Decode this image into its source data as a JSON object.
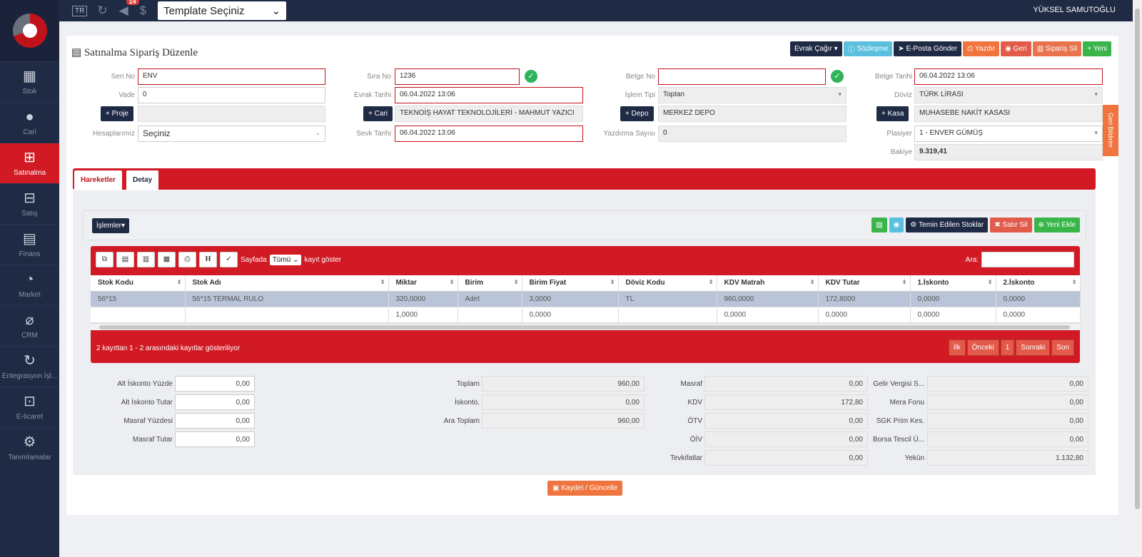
{
  "topbar": {
    "lang": "TR",
    "notif_count": "14",
    "template": "Template Seçiniz",
    "user": "YÜKSEL SAMUTOĞLU"
  },
  "sidebar": {
    "items": [
      {
        "label": "Stok",
        "icon": "cubes-icon"
      },
      {
        "label": "Cari",
        "icon": "user-icon"
      },
      {
        "label": "Satınalma",
        "icon": "cart-plus-icon",
        "active": true
      },
      {
        "label": "Satış",
        "icon": "cart-icon"
      },
      {
        "label": "Finans",
        "icon": "archive-icon"
      },
      {
        "label": "Market",
        "icon": "dashboard-icon"
      },
      {
        "label": "CRM",
        "icon": "paperclip-icon"
      },
      {
        "label": "Entegrasyon İşl...",
        "icon": "refresh-icon"
      },
      {
        "label": "E-ticaret",
        "icon": "shopping-cart-icon"
      },
      {
        "label": "Tanımlamalar",
        "icon": "cogs-icon"
      }
    ]
  },
  "header": {
    "title": "Satınalma Sipariş Düzenle",
    "buttons": {
      "evrak": "Evrak Çağır",
      "sozlesme": "Sözleşme",
      "eposta": "E-Posta Gönder",
      "yazdir": "Yazdır",
      "geri": "Geri",
      "sil": "Sipariş Sil",
      "yeni": "Yeni"
    }
  },
  "form": {
    "seri_label": "Seri No",
    "seri": "ENV",
    "sira_label": "Sıra No",
    "sira": "1236",
    "belge_label": "Belge No",
    "belge": "",
    "belge_tarih_label": "Belge Tarihi",
    "belge_tarih": "06.04.2022 13:06",
    "vade_label": "Vade",
    "vade": "0",
    "evrak_tarih_label": "Evrak Tarihi",
    "evrak_tarih": "06.04.2022 13:06",
    "islem_label": "İşlem Tipi",
    "islem": "Toptan",
    "doviz_label": "Döviz",
    "doviz": "TÜRK LİRASI",
    "proje_btn": "Proje",
    "proje": "",
    "cari_btn": "Cari",
    "cari": "TEKNOİŞ HAYAT TEKNOLOJİLERİ - MAHMUT YAZICI",
    "depo_btn": "Depo",
    "depo": "MERKEZ DEPO",
    "kasa_btn": "Kasa",
    "kasa": "MUHASEBE NAKİT KASASI",
    "hesap_label": "Hesaplarımız",
    "hesap": "Seçiniz",
    "sevk_label": "Sevk Tarihi",
    "sevk": "06.04.2022 13:06",
    "yazdirma_label": "Yazdırma Sayısı",
    "yazdirma": "0",
    "plasiyer_label": "Plasiyer",
    "plasiyer": "1 - ENVER GÜMÜŞ",
    "bakiye_label": "Bakiye",
    "bakiye": "9.319,41",
    "side_tab": "Geri Bildirim"
  },
  "tabs": [
    "Hareketler",
    "Detay"
  ],
  "toolbar": {
    "islemler": "İşlemler",
    "temin": "Temin Edilen Stoklar",
    "satir_sil": "Satır Sil",
    "yeni_ekle": "Yeni Ekle"
  },
  "grid": {
    "sayfada": "Sayfada",
    "tumu": "Tümü",
    "kayit": "kayıt göster",
    "ara": "Ara:",
    "columns": [
      "Stok Kodu",
      "Stok Adı",
      "Miktar",
      "Birim",
      "Birim Fiyat",
      "Döviz Kodu",
      "KDV Matrah",
      "KDV Tutar",
      "1.İskonto",
      "2.İskonto"
    ],
    "rows": [
      [
        "56*15",
        "56*15 TERMAL RULO",
        "320,0000",
        "Adet",
        "3,0000",
        "TL",
        "960,0000",
        "172,8000",
        "0,0000",
        "0,0000"
      ],
      [
        "",
        "",
        "1,0000",
        "",
        "0,0000",
        "",
        "0,0000",
        "0,0000",
        "0,0000",
        "0,0000"
      ]
    ],
    "info": "2 kayıttan 1 - 2 arasındaki kayıtlar gösteriliyor",
    "pager": [
      "İlk",
      "Önceki",
      "1",
      "Sonraki",
      "Son"
    ]
  },
  "totals": {
    "alt_isk_yuzde_label": "Alt İskonto Yüzde",
    "alt_isk_yuzde": "0,00",
    "alt_isk_tutar_label": "Alt İskonto Tutar",
    "alt_isk_tutar": "0,00",
    "masraf_yuzde_label": "Masraf Yüzdesi",
    "masraf_yuzde": "0,00",
    "masraf_tutar_label": "Masraf Tutar",
    "masraf_tutar": "0,00",
    "toplam_label": "Toplam",
    "toplam": "960,00",
    "iskonto_label": "İskonto.",
    "iskonto": "0,00",
    "ara_toplam_label": "Ara Toplam",
    "ara_toplam": "960,00",
    "masraf_label": "Masraf",
    "masraf": "0,00",
    "kdv_label": "KDV",
    "kdv": "172,80",
    "otv_label": "ÖTV",
    "otv": "0,00",
    "oiv_label": "ÖİV",
    "oiv": "0,00",
    "tevkifat_label": "Tevkifatlar",
    "tevkifat": "0,00",
    "gelir_label": "Gelir Vergisi S...",
    "gelir": "0,00",
    "mera_label": "Mera Fonu",
    "mera": "0,00",
    "sgk_label": "SGK Prim Kes.",
    "sgk": "0,00",
    "borsa_label": "Borsa Tescil Ü...",
    "borsa": "0,00",
    "yekun_label": "Yekün",
    "yekun": "1.132,80"
  },
  "save": "Kaydet / Güncelle"
}
